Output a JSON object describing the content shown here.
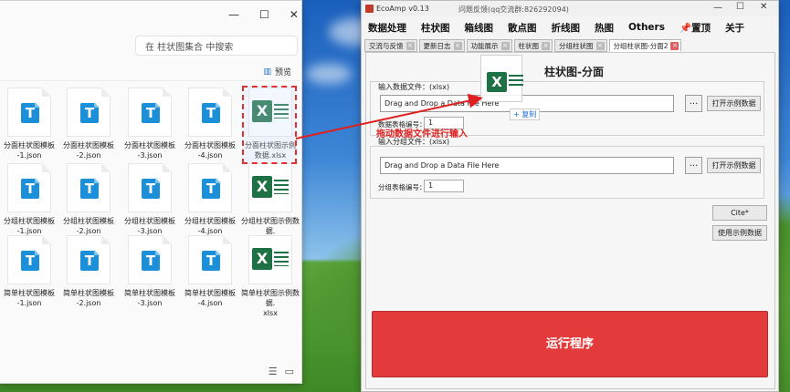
{
  "explorer": {
    "search_placeholder": "在 柱状图集合 中搜索",
    "preview_label": "预览",
    "files": [
      {
        "name": "分面柱状图模板\n-1.json",
        "type": "json"
      },
      {
        "name": "分面柱状图模板\n-2.json",
        "type": "json"
      },
      {
        "name": "分面柱状图模板\n-3.json",
        "type": "json"
      },
      {
        "name": "分面柱状图模板\n-4.json",
        "type": "json"
      },
      {
        "name": "分面柱状图示例\n数据.xlsx",
        "type": "xlsx",
        "selected": true
      },
      {
        "name": "分组柱状图模板\n-1.json",
        "type": "json"
      },
      {
        "name": "分组柱状图模板\n-2.json",
        "type": "json"
      },
      {
        "name": "分组柱状图模板\n-3.json",
        "type": "json"
      },
      {
        "name": "分组柱状图模板\n-4.json",
        "type": "json"
      },
      {
        "name": "分组柱状图示例数据.\nxlsx",
        "type": "xlsx"
      },
      {
        "name": "简单柱状图模板\n-1.json",
        "type": "json"
      },
      {
        "name": "简单柱状图模板\n-2.json",
        "type": "json"
      },
      {
        "name": "简单柱状图模板\n-3.json",
        "type": "json"
      },
      {
        "name": "简单柱状图模板\n-4.json",
        "type": "json"
      },
      {
        "name": "简单柱状图示例数据.\nxlsx",
        "type": "xlsx"
      }
    ]
  },
  "app": {
    "title": "EcoAmp v0.13",
    "feedback": "问题反馈(qq交流群:826292094)",
    "menu": [
      "数据处理",
      "柱状图",
      "箱线图",
      "散点图",
      "折线图",
      "热图",
      "Others",
      "📌置顶",
      "关于"
    ],
    "tabs": [
      "交流与反馈",
      "更新日志",
      "功能展示",
      "柱状图",
      "分组柱状图",
      "分组柱状图-分面2"
    ],
    "panel_title": "柱状图-分面",
    "data_group": {
      "label": "输入数据文件：(xlsx)",
      "drop_text": "Drag and Drop a Data File Here",
      "browse": "...",
      "open_example": "打开示例数据",
      "sheet_label": "数据表格编号：",
      "sheet_value": "1"
    },
    "group_group": {
      "label": "输入分组文件：(xlsx)",
      "drop_text": "Drag and Drop a Data File Here",
      "browse": "...",
      "open_example": "打开示例数据",
      "sheet_label": "分组表格编号：",
      "sheet_value": "1"
    },
    "cite": "Cite*",
    "use_example": "使用示例数据",
    "run": "运行程序"
  },
  "drag": {
    "label": "拖动数据文件进行输入",
    "copy_badge": "+ 复制"
  },
  "colors": {
    "run": "#e33b3b",
    "excel": "#1e7145",
    "json_icon": "#1c8fd9",
    "annotation": "#e02020"
  }
}
